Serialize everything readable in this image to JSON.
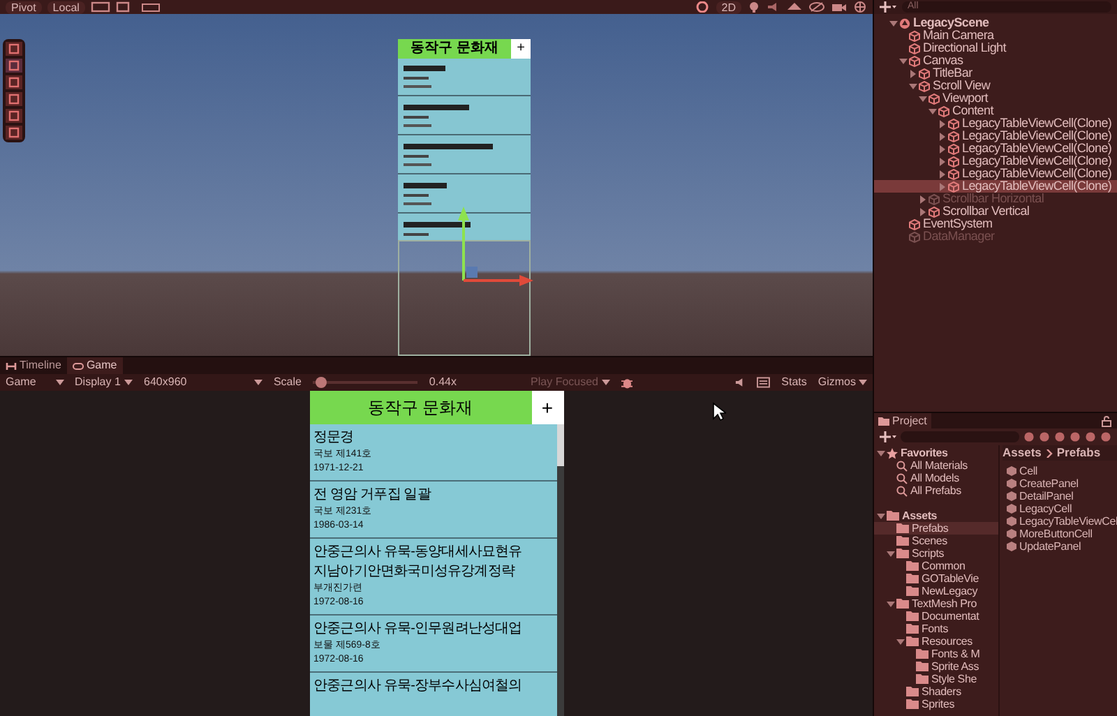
{
  "scene_toolbar": {
    "pivot": "Pivot",
    "local": "Local",
    "mode_2d": "2D"
  },
  "scene_view": {
    "canvas_title": "동작구 문화재",
    "canvas_button": "+"
  },
  "game_tabs": [
    {
      "label": "Timeline",
      "selected": false
    },
    {
      "label": "Game",
      "selected": true
    }
  ],
  "game_toolbar": {
    "view": "Game",
    "display": "Display 1",
    "resolution": "640x960",
    "scale_label": "Scale",
    "scale": {
      "level": 0.03
    },
    "scale_reading": "0.44x",
    "play_mode": "Play Focused",
    "stats": "Stats",
    "gizmos": "Gizmos"
  },
  "game_view": {
    "title": "동작구 문화재",
    "add_button": "+",
    "cells": [
      {
        "lines": [
          "정문경",
          "국보 제141호",
          "1971-12-21"
        ]
      },
      {
        "lines": [
          "전 영암 거푸집 일괄",
          "국보 제231호",
          "1986-03-14"
        ]
      },
      {
        "lines": [
          "안중근의사 유묵-동양대세사묘현유",
          "지남아기안면화국미성유강계정략",
          "부개진가련",
          "1972-08-16"
        ]
      },
      {
        "lines": [
          "안중근의사 유묵-인무원려난성대업",
          "보물 제569-8호",
          "1972-08-16"
        ]
      },
      {
        "lines": [
          "안중근의사 유묵-장부수사심여철의"
        ]
      }
    ]
  },
  "hierarchy": {
    "search_placeholder": "All",
    "items": [
      {
        "label": "LegacyScene",
        "kind": "scene",
        "active": true,
        "selected": false,
        "expanded": true,
        "children": [
          {
            "label": "Main Camera",
            "kind": "object",
            "active": true,
            "selected": false
          },
          {
            "label": "Directional Light",
            "kind": "object",
            "active": true,
            "selected": false
          },
          {
            "label": "Canvas",
            "kind": "object",
            "active": true,
            "selected": false,
            "expanded": true,
            "children": [
              {
                "label": "TitleBar",
                "kind": "object",
                "active": true,
                "selected": false,
                "expanded": false
              },
              {
                "label": "Scroll View",
                "kind": "object",
                "active": true,
                "selected": false,
                "expanded": true,
                "children": [
                  {
                    "label": "Viewport",
                    "kind": "object",
                    "active": true,
                    "selected": false,
                    "expanded": true,
                    "children": [
                      {
                        "label": "Content",
                        "kind": "object",
                        "active": true,
                        "selected": false,
                        "expanded": true,
                        "children": [
                          {
                            "label": "LegacyTableViewCell(Clone)",
                            "kind": "object",
                            "active": true,
                            "selected": false,
                            "expanded": false
                          },
                          {
                            "label": "LegacyTableViewCell(Clone)",
                            "kind": "object",
                            "active": true,
                            "selected": false,
                            "expanded": false
                          },
                          {
                            "label": "LegacyTableViewCell(Clone)",
                            "kind": "object",
                            "active": true,
                            "selected": false,
                            "expanded": false
                          },
                          {
                            "label": "LegacyTableViewCell(Clone)",
                            "kind": "object",
                            "active": true,
                            "selected": false,
                            "expanded": false
                          },
                          {
                            "label": "LegacyTableViewCell(Clone)",
                            "kind": "object",
                            "active": true,
                            "selected": false,
                            "expanded": false
                          },
                          {
                            "label": "LegacyTableViewCell(Clone)",
                            "kind": "object",
                            "active": true,
                            "selected": true,
                            "expanded": false
                          }
                        ]
                      }
                    ]
                  },
                  {
                    "label": "Scrollbar Horizontal",
                    "kind": "object",
                    "active": false,
                    "selected": false,
                    "expanded": false
                  },
                  {
                    "label": "Scrollbar Vertical",
                    "kind": "object",
                    "active": true,
                    "selected": false,
                    "expanded": false
                  }
                ]
              }
            ]
          },
          {
            "label": "EventSystem",
            "kind": "object",
            "active": true,
            "selected": false
          },
          {
            "label": "DataManager",
            "kind": "object",
            "active": false,
            "selected": false
          }
        ]
      }
    ]
  },
  "project": {
    "title": "Project",
    "breadcrumb": [
      "Assets",
      "Prefabs"
    ],
    "tree": [
      {
        "label": "Favorites",
        "kind": "favorites",
        "selected": false,
        "expanded": true,
        "children": [
          {
            "label": "All Materials",
            "kind": "search",
            "selected": false
          },
          {
            "label": "All Models",
            "kind": "search",
            "selected": false
          },
          {
            "label": "All Prefabs",
            "kind": "search",
            "selected": false
          }
        ]
      },
      {
        "label": "Assets",
        "kind": "folder",
        "selected": false,
        "expanded": true,
        "children": [
          {
            "label": "Prefabs",
            "kind": "folder",
            "selected": true
          },
          {
            "label": "Scenes",
            "kind": "folder",
            "selected": false
          },
          {
            "label": "Scripts",
            "kind": "folder",
            "selected": false,
            "expanded": true,
            "children": [
              {
                "label": "Common",
                "kind": "folder",
                "selected": false
              },
              {
                "label": "GOTableVie",
                "kind": "folder",
                "selected": false
              },
              {
                "label": "NewLegacy",
                "kind": "folder",
                "selected": false
              }
            ]
          },
          {
            "label": "TextMesh Pro",
            "kind": "folder",
            "selected": false,
            "expanded": true,
            "children": [
              {
                "label": "Documentat",
                "kind": "folder",
                "selected": false
              },
              {
                "label": "Fonts",
                "kind": "folder",
                "selected": false
              },
              {
                "label": "Resources",
                "kind": "folder",
                "selected": false,
                "expanded": true,
                "children": [
                  {
                    "label": "Fonts & M",
                    "kind": "folder",
                    "selected": false
                  },
                  {
                    "label": "Sprite Ass",
                    "kind": "folder",
                    "selected": false
                  },
                  {
                    "label": "Style She",
                    "kind": "folder",
                    "selected": false
                  }
                ]
              },
              {
                "label": "Shaders",
                "kind": "folder",
                "selected": false
              },
              {
                "label": "Sprites",
                "kind": "folder",
                "selected": false
              }
            ]
          }
        ]
      }
    ],
    "assets": [
      "Cell",
      "CreatePanel",
      "DetailPanel",
      "LegacyCell",
      "LegacyTableViewCel",
      "MoreButtonCell",
      "UpdatePanel"
    ]
  }
}
